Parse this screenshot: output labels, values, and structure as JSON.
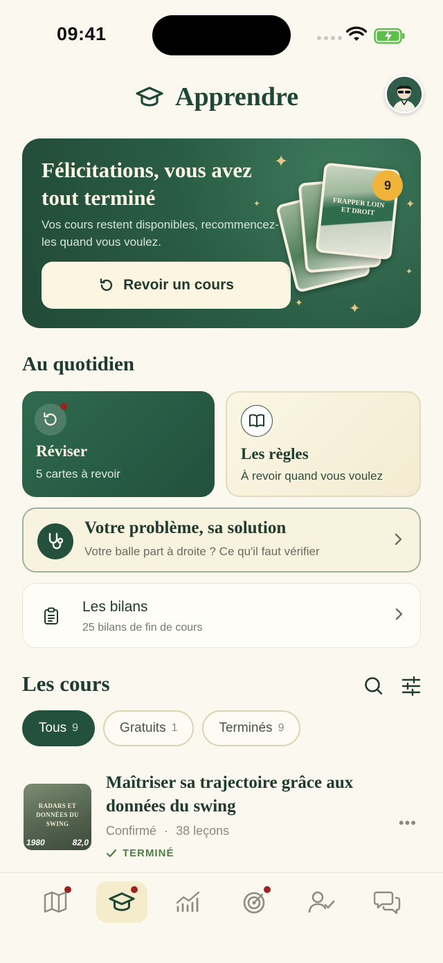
{
  "status": {
    "time": "09:41"
  },
  "header": {
    "title": "Apprendre",
    "title_icon": "graduation-cap-icon",
    "avatar_icon": "user-avatar"
  },
  "hero": {
    "title": "Félicitations, vous avez tout terminé",
    "subtitle": "Vos cours restent disponibles, recommencez-les quand vous voulez.",
    "button_label": "Revoir un cours",
    "card_title": "FRAPPER LOIN ET DROIT",
    "badge_count": "9"
  },
  "daily": {
    "heading": "Au quotidien",
    "reviser": {
      "title": "Réviser",
      "subtitle": "5 cartes à revoir"
    },
    "regles": {
      "title": "Les règles",
      "subtitle": "À revoir quand vous voulez"
    },
    "problem": {
      "title": "Votre problème, sa solution",
      "subtitle": "Votre balle part à droite ? Ce qu'il faut vérifier"
    },
    "bilans": {
      "title": "Les bilans",
      "subtitle": "25 bilans de fin de cours"
    }
  },
  "courses": {
    "heading": "Les cours",
    "filters": [
      {
        "label": "Tous",
        "count": "9"
      },
      {
        "label": "Gratuits",
        "count": "1"
      },
      {
        "label": "Terminés",
        "count": "9"
      }
    ],
    "items": [
      {
        "title": "Maîtriser sa trajectoire grâce aux données du swing",
        "level": "Confirmé",
        "separator": "·",
        "lessons": "38 leçons",
        "status": "TERMINÉ",
        "thumb_title": "RADARS ET DONNÉES DU SWING",
        "thumb_left": "1980",
        "thumb_right": "82,0"
      }
    ]
  },
  "tabbar": {
    "items": [
      "map-icon",
      "graduation-cap-icon",
      "stats-icon",
      "target-icon",
      "profile-check-icon",
      "chat-icon"
    ],
    "active": "graduation-cap-icon"
  },
  "colors": {
    "primary": "#23513d",
    "background": "#fbf9ef",
    "accent_gold": "#f0b43a",
    "notification": "#9d2323"
  }
}
